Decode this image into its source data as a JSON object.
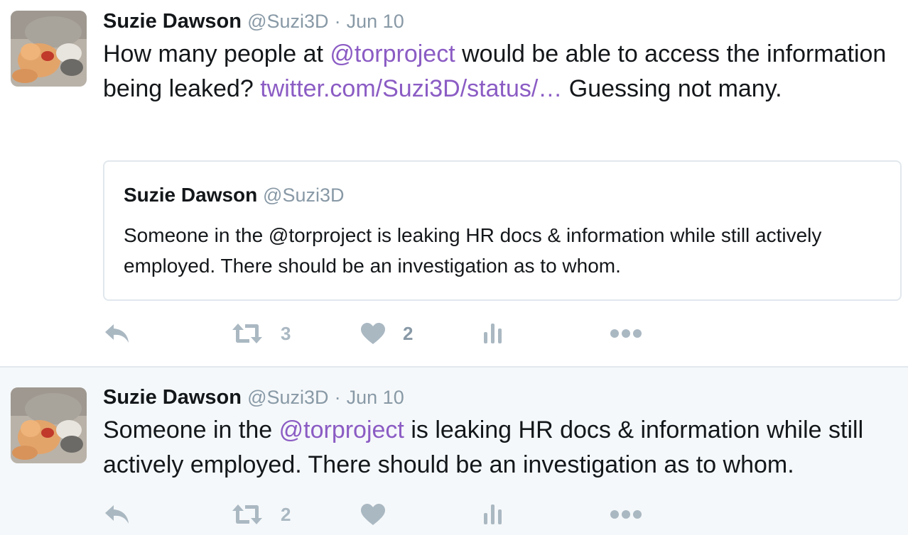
{
  "colors": {
    "link": "#8b5cc4",
    "secondary_text": "#8899a6",
    "icon": "#aab8c2",
    "highlight_bg": "#f5f8fa"
  },
  "tweets": [
    {
      "fullname": "Suzie Dawson",
      "username": "@Suzi3D",
      "separator": "·",
      "timestamp": "Jun 10",
      "text_parts": {
        "p1": "How many people at ",
        "mention": "@torproject",
        "p2": " would be able to access the information being leaked? ",
        "link": "twitter.com/Suzi3D/status/…",
        "p3": " Guessing not many."
      },
      "quote": {
        "fullname": "Suzie Dawson",
        "username": "@Suzi3D",
        "text": "Someone in the @torproject is leaking HR docs & information while still actively employed. There should be an investigation as to whom."
      },
      "actions": {
        "reply_icon": "reply-icon",
        "retweet_icon": "retweet-icon",
        "retweet_count": "3",
        "like_icon": "heart-icon",
        "like_count": "2",
        "analytics_icon": "analytics-icon",
        "more_icon": "more-dots-icon"
      }
    },
    {
      "fullname": "Suzie Dawson",
      "username": "@Suzi3D",
      "separator": "·",
      "timestamp": "Jun 10",
      "text_parts": {
        "p1": "Someone in the ",
        "mention": "@torproject",
        "p2": " is leaking HR docs & information while still actively employed. There should be an investigation as to whom."
      },
      "actions": {
        "reply_icon": "reply-icon",
        "retweet_icon": "retweet-icon",
        "retweet_count": "2",
        "like_icon": "heart-icon",
        "analytics_icon": "analytics-icon",
        "more_icon": "more-dots-icon"
      }
    }
  ]
}
